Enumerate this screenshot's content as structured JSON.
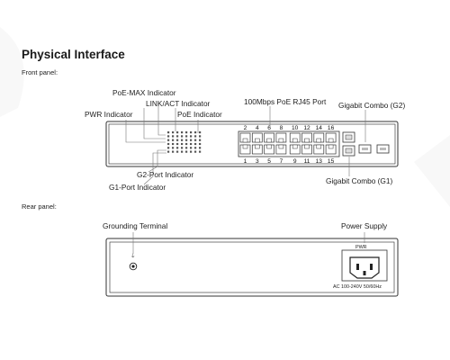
{
  "heading": "Physical Interface",
  "front_panel": {
    "label": "Front panel:",
    "callouts": {
      "poe_max": "PoE-MAX Indicator",
      "link_act": "LINK/ACT Indicator",
      "pwr": "PWR Indicator",
      "poe": "PoE Indicator",
      "rj45": "100Mbps PoE RJ45 Port",
      "combo_g2": "Gigabit Combo (G2)",
      "g2_port": "G2-Port Indicator",
      "g1_port": "G1-Port Indicator",
      "combo_g1": "Gigabit Combo (G1)"
    },
    "port_numbers_top": [
      "2",
      "4",
      "6",
      "8",
      "10",
      "12",
      "14",
      "16"
    ],
    "port_numbers_bottom": [
      "1",
      "3",
      "5",
      "7",
      "9",
      "11",
      "13",
      "15"
    ]
  },
  "rear_panel": {
    "label": "Rear panel:",
    "callouts": {
      "grounding": "Grounding Terminal",
      "power_supply": "Power Supply"
    },
    "pwr_label": "PWR",
    "ac_rating": "AC 100-240V 50/60Hz"
  }
}
